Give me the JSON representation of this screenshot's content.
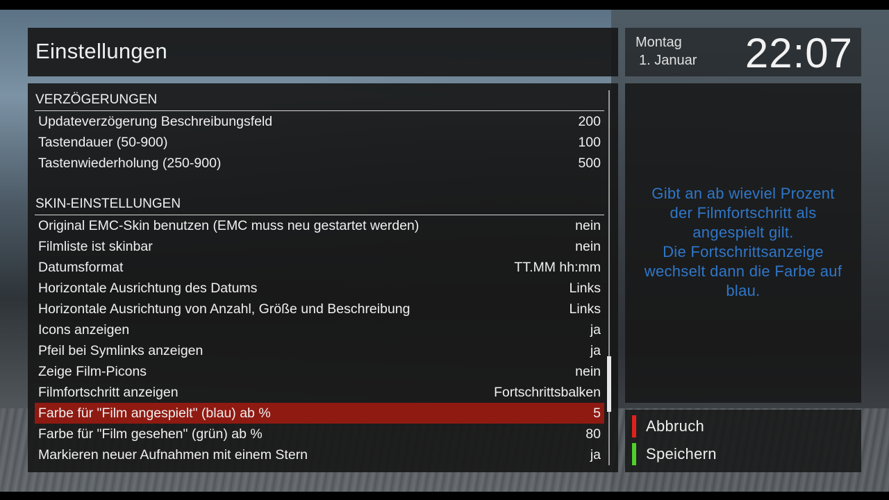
{
  "header": {
    "title": "Einstellungen"
  },
  "clock": {
    "day": "Montag",
    "date": "1. Januar",
    "time": "22:07"
  },
  "sections": [
    {
      "title": "VERZÖGERUNGEN",
      "items": [
        {
          "label": "Updateverzögerung Beschreibungsfeld",
          "value": "200"
        },
        {
          "label": "Tastendauer (50-900)",
          "value": "100"
        },
        {
          "label": "Tastenwiederholung (250-900)",
          "value": "500"
        }
      ]
    },
    {
      "title": "SKIN-EINSTELLUNGEN",
      "items": [
        {
          "label": "Original EMC-Skin benutzen (EMC muss neu gestartet werden)",
          "value": "nein"
        },
        {
          "label": "Filmliste ist skinbar",
          "value": "nein"
        },
        {
          "label": "Datumsformat",
          "value": "TT.MM hh:mm"
        },
        {
          "label": "Horizontale Ausrichtung des Datums",
          "value": "Links"
        },
        {
          "label": "Horizontale Ausrichtung von Anzahl, Größe und Beschreibung",
          "value": "Links"
        },
        {
          "label": "Icons anzeigen",
          "value": "ja"
        },
        {
          "label": "Pfeil bei Symlinks anzeigen",
          "value": "ja"
        },
        {
          "label": "Zeige Film-Picons",
          "value": "nein"
        },
        {
          "label": "Filmfortschritt anzeigen",
          "value": "Fortschrittsbalken"
        },
        {
          "label": "Farbe für \"Film angespielt\" (blau) ab %",
          "value": "5",
          "selected": true
        },
        {
          "label": "Farbe für \"Film gesehen\" (grün) ab %",
          "value": "80"
        },
        {
          "label": "Markieren neuer Aufnahmen mit einem Stern",
          "value": "ja"
        }
      ]
    }
  ],
  "description": {
    "lines": [
      "Gibt an ab wieviel Prozent",
      "der Filmfortschritt als",
      "angespielt gilt.",
      "Die Fortschrittsanzeige",
      "wechselt dann die Farbe auf",
      "blau."
    ]
  },
  "buttons": {
    "red": {
      "label": "Abbruch",
      "color": "#e0221a"
    },
    "green": {
      "label": "Speichern",
      "color": "#4fd12a"
    }
  },
  "colors": {
    "selected_row": "#8f1a12",
    "description_text": "#2f77c9"
  }
}
